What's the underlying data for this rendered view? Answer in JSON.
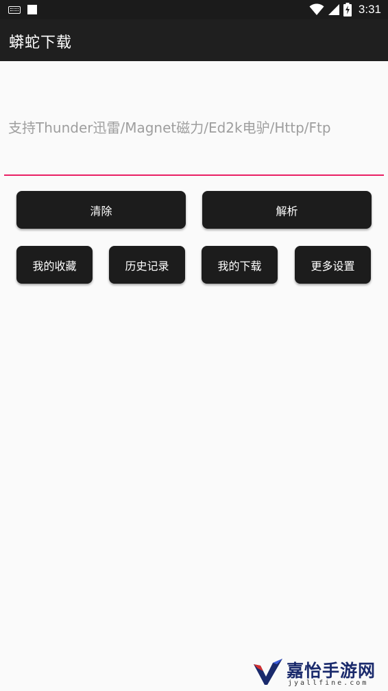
{
  "status_bar": {
    "time": "3:31",
    "icons": [
      "keyboard-icon",
      "notification-square-icon",
      "wifi-icon",
      "signal-icon",
      "battery-charging-icon"
    ]
  },
  "app_bar": {
    "title": "蟒蛇下载"
  },
  "url_input": {
    "placeholder": "支持Thunder迅雷/Magnet磁力/Ed2k电驴/Http/Ftp",
    "value": ""
  },
  "actions": {
    "clear_label": "清除",
    "parse_label": "解析"
  },
  "menu": {
    "favorites_label": "我的收藏",
    "history_label": "历史记录",
    "downloads_label": "我的下载",
    "settings_label": "更多设置"
  },
  "watermark": {
    "name": "嘉怡手游网",
    "site": "jyallfine.com"
  },
  "colors": {
    "accent": "#e91e63",
    "app_bar": "#1f1f1f",
    "status_bar": "#1b1b1b",
    "button": "#1c1c1c",
    "background": "#fafafa"
  }
}
